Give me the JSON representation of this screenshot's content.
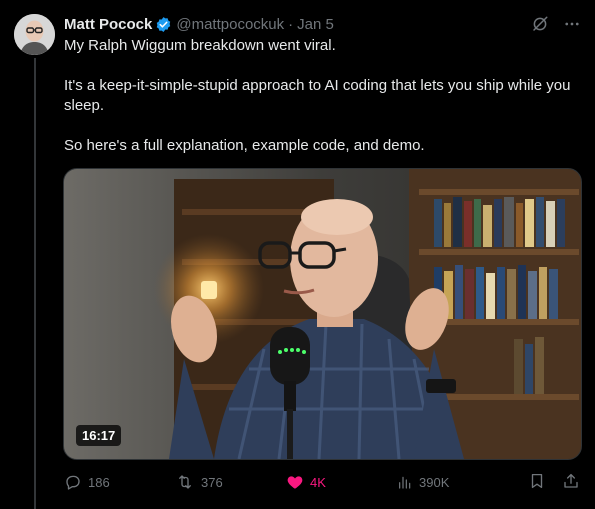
{
  "author": {
    "name": "Matt Pocock",
    "handle": "@mattpocockuk",
    "separator": "·",
    "date": "Jan 5"
  },
  "tweet": {
    "paragraphs": [
      "My Ralph Wiggum breakdown went viral.",
      "It's a keep-it-simple-stupid approach to AI coding that lets you ship while you sleep.",
      "So here's a full explanation, example code, and demo."
    ]
  },
  "media": {
    "duration": "16:17"
  },
  "actions": {
    "replies": "186",
    "reposts": "376",
    "likes": "4K",
    "views": "390K"
  },
  "colors": {
    "background": "#000000",
    "text": "#e7e9ea",
    "muted": "#71767b",
    "verified": "#1d9bf0",
    "like": "#f91880"
  },
  "icons": {
    "verified": "verified-badge-icon",
    "grok": "grok-icon",
    "more": "more-icon",
    "reply": "reply-icon",
    "repost": "repost-icon",
    "like": "heart-icon",
    "views": "views-icon",
    "bookmark": "bookmark-icon",
    "share": "share-icon"
  }
}
